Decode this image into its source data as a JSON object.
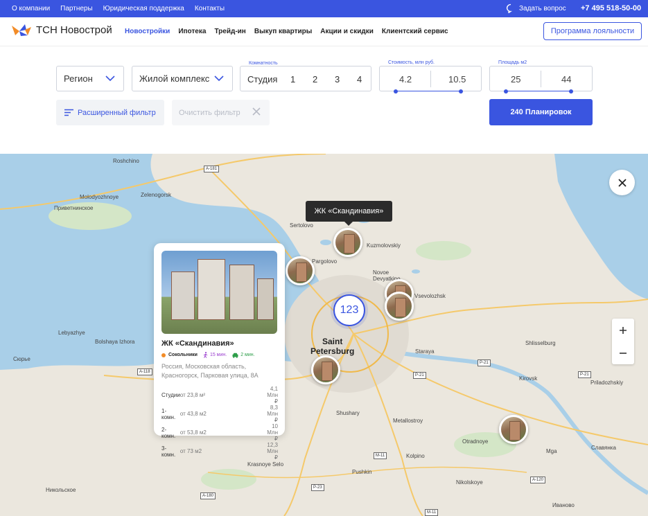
{
  "topbar": {
    "links": [
      "О компании",
      "Партнеры",
      "Юридическая поддержка",
      "Контакты"
    ],
    "ask_label": "Задать вопрос",
    "phone": "+7 495 518-50-00"
  },
  "header": {
    "logo_text": "ТСН Новострой",
    "nav": [
      "Новостройки",
      "Ипотека",
      "Трейд-ин",
      "Выкуп квартиры",
      "Акции и скидки",
      "Клиентский сервис"
    ],
    "loyalty_button": "Программа лояльности"
  },
  "filters": {
    "region": "Регион",
    "complex": "Жилой комплекс",
    "rooms_label": "Комнатность",
    "rooms": [
      "Студия",
      "1",
      "2",
      "3",
      "4"
    ],
    "price_label": "Стоимость, млн руб.",
    "price_min": "4.2",
    "price_max": "10.5",
    "area_label": "Площадь м2",
    "area_min": "25",
    "area_max": "44",
    "advanced": "Расширенный фильтр",
    "clear": "Очистить фильтр",
    "plans_button": "240 Планировок"
  },
  "map": {
    "tooltip": "ЖК «Скандинавия»",
    "cluster_count": "123",
    "labels": {
      "roshchino": "Roshchino",
      "molodyozhnoye": "Molodyozhnoye",
      "zelenogorsk": "Zelenogorsk",
      "privetninskoe": "Приветнинское",
      "sertolovo": "Sertolovo",
      "kuzmolovskiy": "Kuzmolovskiy",
      "pargolovo": "Pargolovo",
      "novoe_devyatkino": "Novoe\nDevyatkino",
      "vsevolozhsk": "Vsevolozhsk",
      "lebyazhye": "Lebyazhye",
      "bolshaya_izhora": "Bolshaya Izhora",
      "syurye": "Сюрье",
      "saint_petersburg": "Saint\nPetersburg",
      "shlisselburg": "Shlisselburg",
      "staraya": "Staraya",
      "kirovsk": "Kirovsk",
      "priladozhskiy": "Priladozhskiy",
      "shushary": "Shushary",
      "metallostroy": "Metallostroy",
      "otradnoye": "Otradnoye",
      "mga": "Mga",
      "slavyanka": "Славянка",
      "kolpino": "Kolpino",
      "krasnoye_selo": "Krasnoye Selo",
      "pushkin": "Pushkin",
      "nikolskoye": "Nikolskoye",
      "nikolskoe_ru": "Никольское",
      "ivanovo": "Иваново"
    },
    "roads": [
      "A-181",
      "A-118",
      "P-21",
      "P-21",
      "P-21",
      "A-120",
      "M-11",
      "P-23",
      "A-180",
      "M-11"
    ]
  },
  "card": {
    "title": "ЖК «Скандинавия»",
    "metro": "Сокольники",
    "walk": "15 мин.",
    "car": "2 мин.",
    "address": "Россия, Московская область, Красногорск, Парковая улица, 8А",
    "rows": [
      {
        "type": "Студии",
        "area": "от 23,8 м²",
        "price": "4,1 Млн ₽"
      },
      {
        "type": "1-комн.",
        "area": "от 43,8 м2",
        "price": "8,3 Млн ₽"
      },
      {
        "type": "2-комн.",
        "area": "от 53,8 м2",
        "price": "10 Млн ₽"
      },
      {
        "type": "3-комн.",
        "area": "от 73 м2",
        "price": "12,3 Млн ₽"
      }
    ]
  },
  "colors": {
    "accent": "#3a55e0",
    "water": "#a9cfe8",
    "land": "#ebe7de"
  }
}
